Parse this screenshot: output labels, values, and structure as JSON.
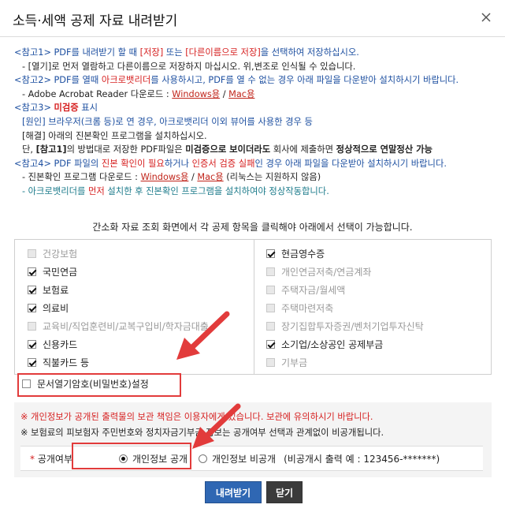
{
  "dialog": {
    "title": "소득·세액 공제 자료 내려받기"
  },
  "notes": {
    "n1_a": "<참고1> PDF를 내려받기 할 때 ",
    "n1_b": "[저장]",
    "n1_c": " 또는 ",
    "n1_d": "[다른이름으로 저장]",
    "n1_e": "을 선택하여 저장하십시오.",
    "n1_sub": "- [열기]로 먼저 열람하고 다른이름으로 저장하지 마십시오. 위,변조로 인식될 수 있습니다.",
    "n2_a": "<참고2> PDF를 열때 ",
    "n2_b": "아크로뱃리더",
    "n2_c": "를 사용하시고, PDF를 열 수 없는 경우 아래 파일을 다운받아 설치하시기 바랍니다.",
    "n2_sub_a": "- Adobe Acrobat Reader 다운로드 : ",
    "n2_link1": "Windows용",
    "n2_sep": " / ",
    "n2_link2": "Mac용",
    "n3_a": "<참고3> ",
    "n3_b": "미검증",
    "n3_c": " 표시",
    "n3_l1": "[원인] 브라우저(크롬 등)로 연 경우, 아크로뱃리더 이외 뷰어를 사용한 경우 등",
    "n3_l2": "[해결] 아래의 진본확인 프로그램을 설치하십시오.",
    "n3_l3_a": "단, ",
    "n3_l3_b": "[참고1]",
    "n3_l3_c": "의 방법대로 저장한 PDF파일은 ",
    "n3_l3_d": "미검증으로 보이더라도",
    "n3_l3_e": " 회사에 제출하면 ",
    "n3_l3_f": "정상적으로 연말정산 가능",
    "n4_a": "<참고4> PDF 파일의 ",
    "n4_b": "진본 확인이 필요",
    "n4_c": "하거나 ",
    "n4_d": "인증서 검증 실패",
    "n4_e": "인 경우 아래 파일을 다운받아 설치하시기 바랍니다.",
    "n4_sub_a": "- 진본확인 프로그램 다운로드 : ",
    "n4_link1": "Windows용",
    "n4_sep": " / ",
    "n4_link2": "Mac용",
    "n4_sub_b": " (리눅스는 지원하지 않음)",
    "n4_sub2_a": "- 아크로뱃리더를 ",
    "n4_sub2_b": "먼저",
    "n4_sub2_c": " 설치한 후 진본확인 프로그램을 설치하여야 정상작동합니다."
  },
  "instruction": "간소화 자료 조회 화면에서 각 공제 항목을 클릭해야 아래에서 선택이 가능합니다.",
  "left_items": [
    {
      "label": "건강보험",
      "checked": false,
      "disabled": true
    },
    {
      "label": "국민연금",
      "checked": true,
      "disabled": false
    },
    {
      "label": "보험료",
      "checked": true,
      "disabled": false
    },
    {
      "label": "의료비",
      "checked": true,
      "disabled": false
    },
    {
      "label": "교육비/직업훈련비/교복구입비/학자금대출",
      "checked": false,
      "disabled": true
    },
    {
      "label": "신용카드",
      "checked": true,
      "disabled": false
    },
    {
      "label": "직불카드 등",
      "checked": true,
      "disabled": false
    }
  ],
  "right_items": [
    {
      "label": "현금영수증",
      "checked": true,
      "disabled": false
    },
    {
      "label": "개인연금저축/연금계좌",
      "checked": false,
      "disabled": true
    },
    {
      "label": "주택자금/월세액",
      "checked": false,
      "disabled": true
    },
    {
      "label": "주택마련저축",
      "checked": false,
      "disabled": true
    },
    {
      "label": "장기집합투자증권/벤처기업투자신탁",
      "checked": false,
      "disabled": true
    },
    {
      "label": "소기업/소상공인 공제부금",
      "checked": true,
      "disabled": false
    },
    {
      "label": "기부금",
      "checked": false,
      "disabled": true
    }
  ],
  "password_option": {
    "label": "문서열기암호(비밀번호)설정",
    "checked": false
  },
  "bottom": {
    "warn1": "※ 개인정보가 공개된 출력물의 보관 책임은 이용자에게 있습니다. 보관에 유의하시기 바랍니다.",
    "warn2": "※ 보험료의 피보험자 주민번호와 정치자금기부금 정보는 공개여부 선택과 관계없이 비공개됩니다.",
    "disclose_label_star": "*",
    "disclose_label": "공개여부",
    "radio_public": "개인정보 공개",
    "radio_private": "개인정보 비공개",
    "private_note": "(비공개시 출력 예 : 123456-*******)"
  },
  "buttons": {
    "download": "내려받기",
    "close": "닫기"
  },
  "colors": {
    "primary_button": "#2f67b3",
    "close_button": "#3b3b3b",
    "annotation_red": "#e23b3b"
  }
}
